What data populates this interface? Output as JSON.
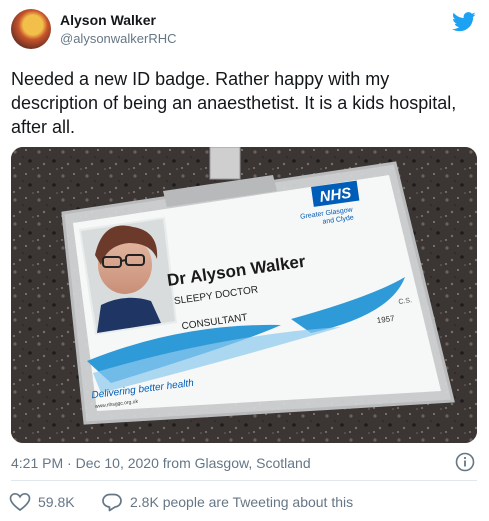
{
  "author": {
    "name": "Alyson Walker",
    "handle": "@alysonwalkerRHC"
  },
  "tweet_text": "Needed a new ID badge.  Rather happy with my description of being an anaesthetist. It is a kids hospital, after all.",
  "badge": {
    "org": "NHS",
    "org_sub1": "Greater Glasgow",
    "org_sub2": "and Clyde",
    "holder_name": "Dr Alyson Walker",
    "role": "SLEEPY DOCTOR",
    "title": "CONSULTANT",
    "initials": "C.S.",
    "number": "1957",
    "slogan": "Delivering better health",
    "web": "www.nhsggc.org.uk"
  },
  "meta": {
    "timestamp": "4:21 PM · Dec 10, 2020 from Glasgow, Scotland"
  },
  "actions": {
    "likes": "59.8K",
    "reply_text": "2.8K people are Tweeting about this"
  },
  "colors": {
    "twitter_blue": "#1da1f2",
    "nhs_blue": "#005eb8",
    "secondary_text": "#657786"
  },
  "icons": [
    "twitter-bird-icon",
    "info-icon",
    "heart-icon",
    "reply-bubble-icon"
  ]
}
